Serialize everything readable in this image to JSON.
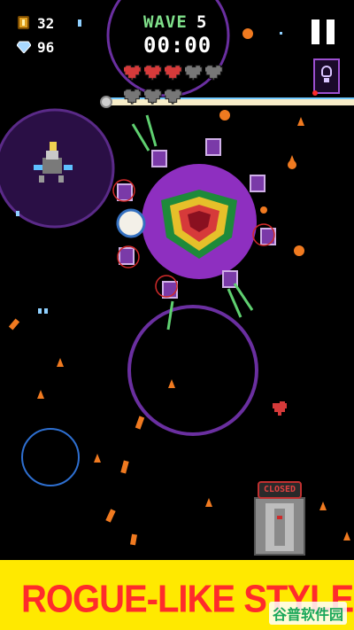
{
  "hud": {
    "coins": "32",
    "gems": "96",
    "wave_label": "WAVE",
    "wave_number": "5",
    "timer": "00:00",
    "health": {
      "full_hearts": 3,
      "total_hearts": 8
    }
  },
  "buttons": {
    "pause_icon": "pause-icon",
    "hint_icon": "lightbulb-icon"
  },
  "objects": {
    "closed_sign": "CLOSED"
  },
  "banner": {
    "text": "ROGUE-LIKE STYLE",
    "color": "#ff2b2b",
    "background": "#ffe900"
  },
  "watermark": "谷普软件园",
  "colors": {
    "boss": "#8e2fc0",
    "gold": "#e0a020",
    "heart_full": "#d63a3a",
    "heart_empty": "#777777",
    "wave_label": "#7fe08a"
  }
}
